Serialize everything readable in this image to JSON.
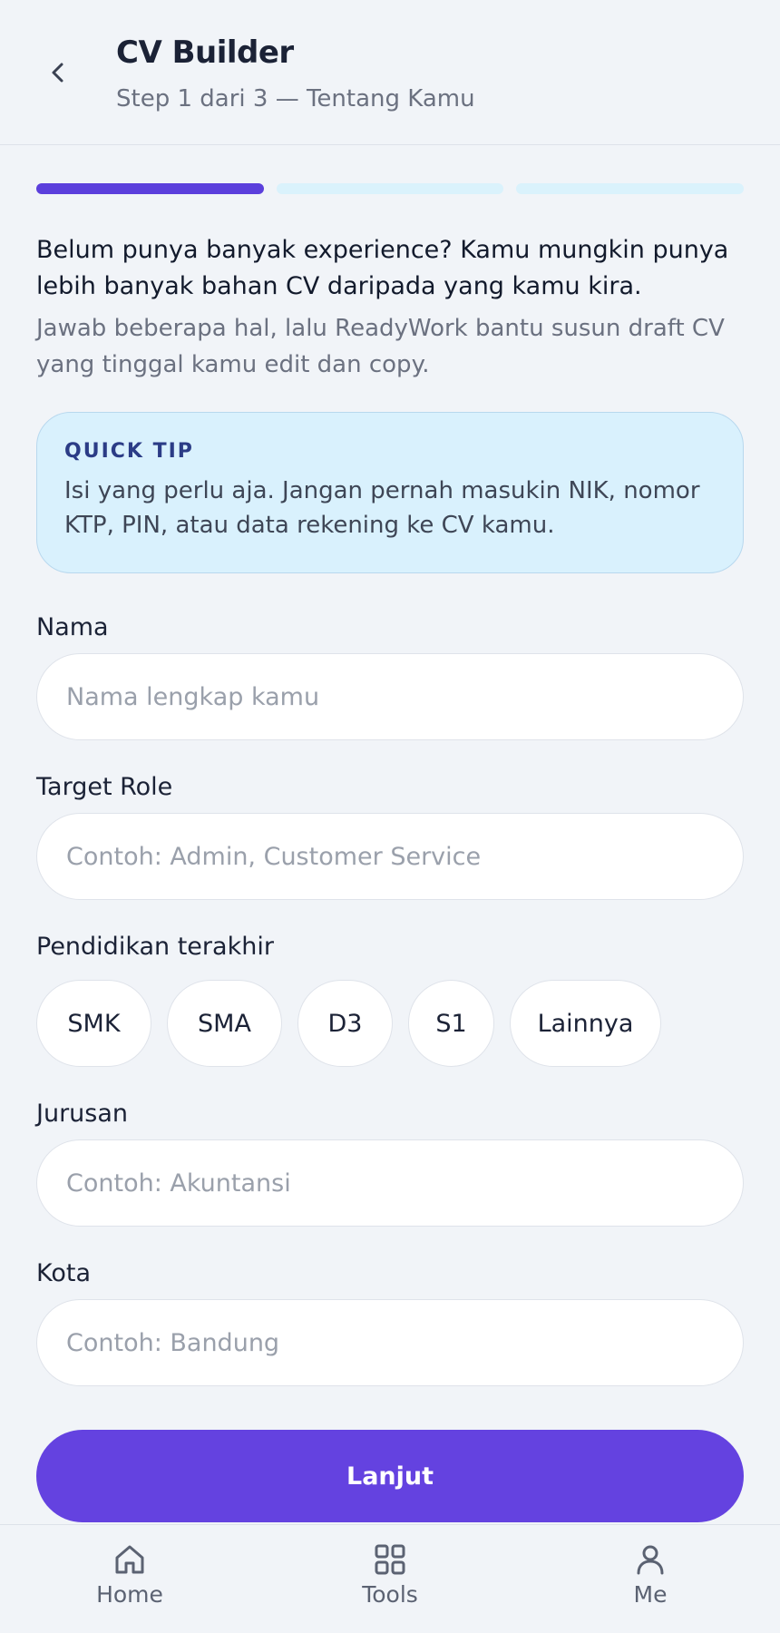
{
  "header": {
    "title": "CV Builder",
    "subtitle": "Step 1 dari 3 — Tentang Kamu"
  },
  "progress": {
    "current_step": 1,
    "total_steps": 3
  },
  "intro": {
    "heading": "Belum punya banyak experience? Kamu mungkin punya lebih banyak bahan CV daripada yang kamu kira.",
    "body": "Jawab beberapa hal, lalu ReadyWork bantu susun draft CV yang tinggal kamu edit dan copy."
  },
  "tip": {
    "label": "QUICK TIP",
    "text": "Isi yang perlu aja. Jangan pernah masukin NIK, nomor KTP, PIN, atau data rekening ke CV kamu."
  },
  "form": {
    "nama": {
      "label": "Nama",
      "placeholder": "Nama lengkap kamu",
      "value": ""
    },
    "target_role": {
      "label": "Target Role",
      "placeholder": "Contoh: Admin, Customer Service",
      "value": ""
    },
    "pendidikan": {
      "label": "Pendidikan terakhir",
      "options": [
        "SMK",
        "SMA",
        "D3",
        "S1",
        "Lainnya"
      ]
    },
    "jurusan": {
      "label": "Jurusan",
      "placeholder": "Contoh: Akuntansi",
      "value": ""
    },
    "kota": {
      "label": "Kota",
      "placeholder": "Contoh: Bandung",
      "value": ""
    }
  },
  "cta": {
    "label": "Lanjut"
  },
  "nav": {
    "items": [
      {
        "label": "Home",
        "icon": "home-icon"
      },
      {
        "label": "Tools",
        "icon": "grid-icon"
      },
      {
        "label": "Me",
        "icon": "person-icon"
      }
    ]
  },
  "colors": {
    "accent": "#6442e0",
    "progress_active": "#5b3fdc",
    "progress_inactive": "#daf2fc",
    "tip_background": "#d9f1fd",
    "background": "#f1f4f8"
  }
}
